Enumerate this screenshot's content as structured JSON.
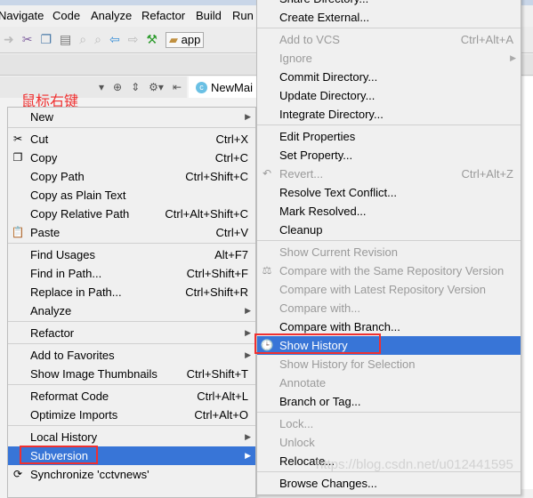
{
  "menubar": [
    "Navigate",
    "Code",
    "Analyze",
    "Refactor",
    "Build",
    "Run"
  ],
  "toolbar": {
    "run_config": "app"
  },
  "editor_tab": "NewMai",
  "annotation": "鼠标右键",
  "watermark": "https://blog.csdn.net/u012441595",
  "context_menu": [
    {
      "label": "New",
      "arrow": true
    },
    {
      "sep": true
    },
    {
      "label": "Cut",
      "shortcut": "Ctrl+X",
      "icon": "scissors-icon",
      "glyph": "✂"
    },
    {
      "label": "Copy",
      "shortcut": "Ctrl+C",
      "icon": "copy-icon",
      "glyph": "❐"
    },
    {
      "label": "Copy Path",
      "shortcut": "Ctrl+Shift+C"
    },
    {
      "label": "Copy as Plain Text"
    },
    {
      "label": "Copy Relative Path",
      "shortcut": "Ctrl+Alt+Shift+C"
    },
    {
      "label": "Paste",
      "shortcut": "Ctrl+V",
      "icon": "paste-icon",
      "glyph": "📋"
    },
    {
      "sep": true
    },
    {
      "label": "Find Usages",
      "shortcut": "Alt+F7"
    },
    {
      "label": "Find in Path...",
      "shortcut": "Ctrl+Shift+F"
    },
    {
      "label": "Replace in Path...",
      "shortcut": "Ctrl+Shift+R"
    },
    {
      "label": "Analyze",
      "arrow": true
    },
    {
      "sep": true
    },
    {
      "label": "Refactor",
      "arrow": true
    },
    {
      "sep": true
    },
    {
      "label": "Add to Favorites",
      "arrow": true
    },
    {
      "label": "Show Image Thumbnails",
      "shortcut": "Ctrl+Shift+T"
    },
    {
      "sep": true
    },
    {
      "label": "Reformat Code",
      "shortcut": "Ctrl+Alt+L"
    },
    {
      "label": "Optimize Imports",
      "shortcut": "Ctrl+Alt+O"
    },
    {
      "sep": true
    },
    {
      "label": "Local History",
      "arrow": true
    },
    {
      "label": "Subversion",
      "arrow": true,
      "selected": true
    },
    {
      "label": "Synchronize 'cctvnews'",
      "icon": "sync-icon",
      "glyph": "⟳"
    }
  ],
  "subversion_menu": [
    {
      "label": "Share Directory..."
    },
    {
      "label": "Create External..."
    },
    {
      "sep": true
    },
    {
      "label": "Add to VCS",
      "shortcut": "Ctrl+Alt+A",
      "disabled": true
    },
    {
      "label": "Ignore",
      "arrow": true,
      "disabled": true
    },
    {
      "label": "Commit Directory..."
    },
    {
      "label": "Update Directory..."
    },
    {
      "label": "Integrate Directory..."
    },
    {
      "sep": true
    },
    {
      "label": "Edit Properties"
    },
    {
      "label": "Set Property..."
    },
    {
      "label": "Revert...",
      "shortcut": "Ctrl+Alt+Z",
      "disabled": true,
      "icon": "revert-icon",
      "glyph": "↶"
    },
    {
      "label": "Resolve Text Conflict..."
    },
    {
      "label": "Mark Resolved..."
    },
    {
      "label": "Cleanup"
    },
    {
      "sep": true
    },
    {
      "label": "Show Current Revision",
      "disabled": true
    },
    {
      "label": "Compare with the Same Repository Version",
      "disabled": true,
      "icon": "compare-icon",
      "glyph": "⚖"
    },
    {
      "label": "Compare with Latest Repository Version",
      "disabled": true
    },
    {
      "label": "Compare with...",
      "disabled": true
    },
    {
      "label": "Compare with Branch..."
    },
    {
      "label": "Show History",
      "selected": true,
      "icon": "history-icon",
      "glyph": "🕒"
    },
    {
      "label": "Show History for Selection",
      "disabled": true
    },
    {
      "label": "Annotate",
      "disabled": true
    },
    {
      "label": "Branch or Tag..."
    },
    {
      "sep": true
    },
    {
      "label": "Lock...",
      "disabled": true
    },
    {
      "label": "Unlock",
      "disabled": true
    },
    {
      "label": "Relocate..."
    },
    {
      "sep": true
    },
    {
      "label": "Browse Changes..."
    }
  ],
  "colors": {
    "selection": "#3875d7",
    "highlight_box": "#f03030"
  }
}
